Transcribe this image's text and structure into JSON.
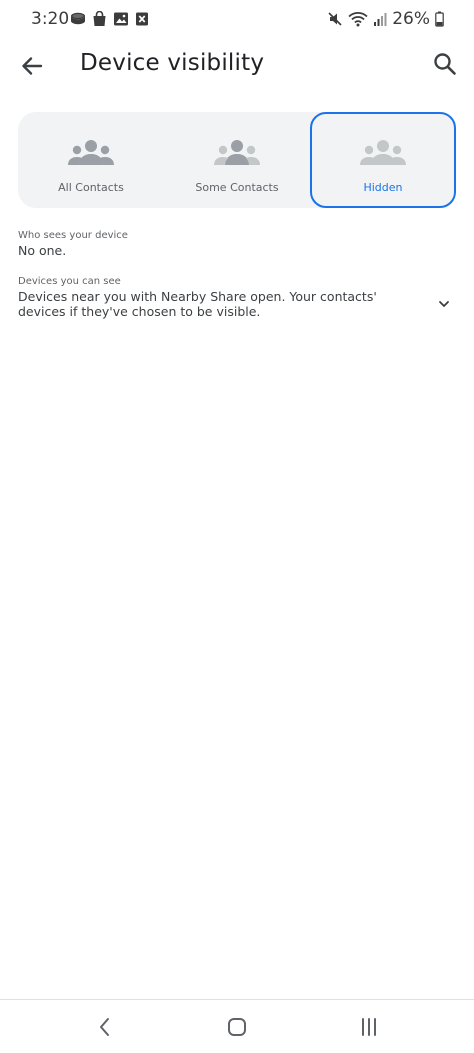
{
  "status_bar": {
    "time": "3:20",
    "battery": "26%"
  },
  "app_bar": {
    "title": "Device visibility"
  },
  "visibility_options": [
    {
      "label": "All Contacts",
      "selected": false
    },
    {
      "label": "Some Contacts",
      "selected": false
    },
    {
      "label": "Hidden",
      "selected": true
    }
  ],
  "who_sees": {
    "caption": "Who sees your device",
    "value": "No one."
  },
  "devices_see": {
    "caption": "Devices you can see",
    "value": "Devices near you with Nearby Share open. Your contacts' devices if they've chosen to be visible."
  },
  "colors": {
    "accent": "#1a73e8",
    "card_bg": "#f1f3f4",
    "icon_gray": "#9aa0a6",
    "icon_light": "#c4c7c9"
  },
  "icons": {
    "back": "arrow-back-icon",
    "search": "search-icon",
    "people": "people-icon",
    "expand": "chevron-down-icon"
  }
}
